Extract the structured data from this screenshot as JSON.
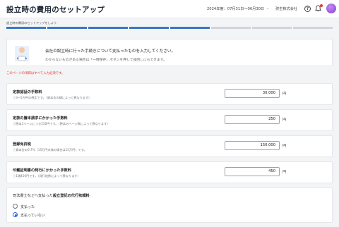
{
  "header": {
    "title": "設立時の費用のセットアップ",
    "fiscal_period": "2024年度：07月31日～06月30日",
    "company": "弥生株式会社",
    "help_glyph": "?"
  },
  "subtitle": "設立時の費用のセットアップをしよう",
  "progress": {
    "completed_steps": 5,
    "total_steps": 8
  },
  "banner": {
    "main": "会社の設立時に行った手続きについて支払ったものを入力してください。",
    "sub": "わからないものがある場合は「一時保存」ボタンを押して後回しにもできます。"
  },
  "required_note": "このページの項目はすべて入力必須です。",
  "fees": [
    {
      "label": "定款認証の手数料",
      "hint": "3～5万円の想定です。（資本金の額によって異なります）",
      "value": "30,000",
      "unit": "円"
    },
    {
      "label": "定款の謄本請求にかかった手数料",
      "hint": "謄本1ページにつき250円です。（謄本のページ数によって異なります）",
      "value": "250",
      "unit": "円"
    },
    {
      "label": "登録免許税",
      "hint": "資本金の0.7%（15万円未満の場合は15万円）です。",
      "value": "150,000",
      "unit": "円"
    },
    {
      "label": "印鑑証明書の発行にかかった手数料",
      "hint": "1通450円です。（発行枚数によって異なります）",
      "value": "450",
      "unit": "円"
    }
  ],
  "agent_fee": {
    "question_prefix": "司法書士などへ支払った",
    "question_bold": "設立登記の代行依頼料",
    "options": [
      {
        "label": "支払った",
        "selected": false
      },
      {
        "label": "支払っていない",
        "selected": true
      }
    ]
  },
  "colors": {
    "accent": "#3b78c4",
    "required": "#e53935",
    "avatar": "#8a3fd6"
  }
}
